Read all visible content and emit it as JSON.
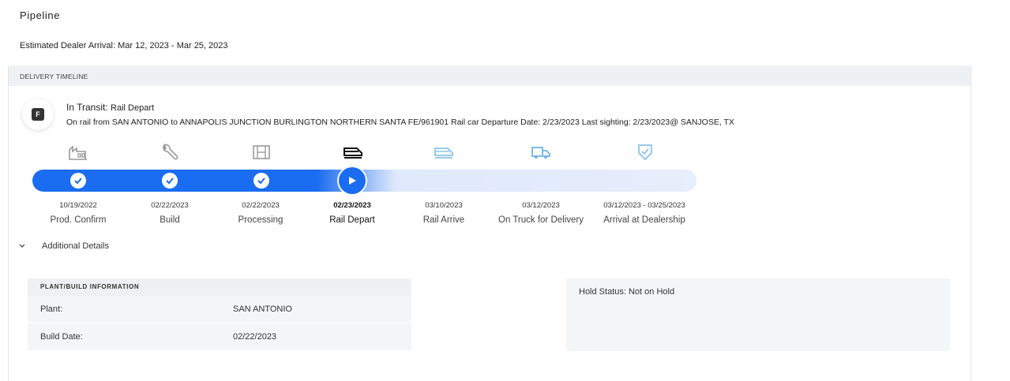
{
  "page": {
    "title": "Pipeline",
    "estimated_arrival": "Estimated Dealer Arrival: Mar 12, 2023 - Mar 25, 2023"
  },
  "card": {
    "header": "DELIVERY TIMELINE",
    "status_badge": "F",
    "status_label": "In Transit:",
    "status_sub": "Rail Depart",
    "description": "On rail from SAN ANTONIO to ANNAPOLIS JUNCTION BURLINGTON NORTHERN SANTA FE/961901 Rail car Departure Date: 2/23/2023 Last sighting: 2/23/2023@ SANJOSE, TX"
  },
  "timeline": {
    "accent_color": "#1a6cf0",
    "steps": [
      {
        "label": "Prod. Confirm",
        "date": "10/19/2022",
        "icon": "factory-icon",
        "state": "complete"
      },
      {
        "label": "Build",
        "date": "02/22/2023",
        "icon": "wrench-icon",
        "state": "complete"
      },
      {
        "label": "Processing",
        "date": "02/22/2023",
        "icon": "processing-icon",
        "state": "complete"
      },
      {
        "label": "Rail Depart",
        "date": "02/23/2023",
        "icon": "train-icon",
        "state": "current"
      },
      {
        "label": "Rail Arrive",
        "date": "03/10/2023",
        "icon": "train-arrive-icon",
        "state": "pending"
      },
      {
        "label": "On Truck for Delivery",
        "date": "03/12/2023",
        "icon": "truck-icon",
        "state": "pending"
      },
      {
        "label": "Arrival at Dealership",
        "date": "03/12/2023 - 03/25/2023",
        "icon": "shield-check-icon",
        "state": "pending"
      }
    ]
  },
  "additional": {
    "label": "Additional Details"
  },
  "plant_info": {
    "header": "PLANT/BUILD INFORMATION",
    "rows": [
      {
        "key": "Plant:",
        "value": "SAN ANTONIO"
      },
      {
        "key": "Build Date:",
        "value": "02/22/2023"
      }
    ]
  },
  "hold": {
    "status": "Hold Status: Not on Hold"
  }
}
